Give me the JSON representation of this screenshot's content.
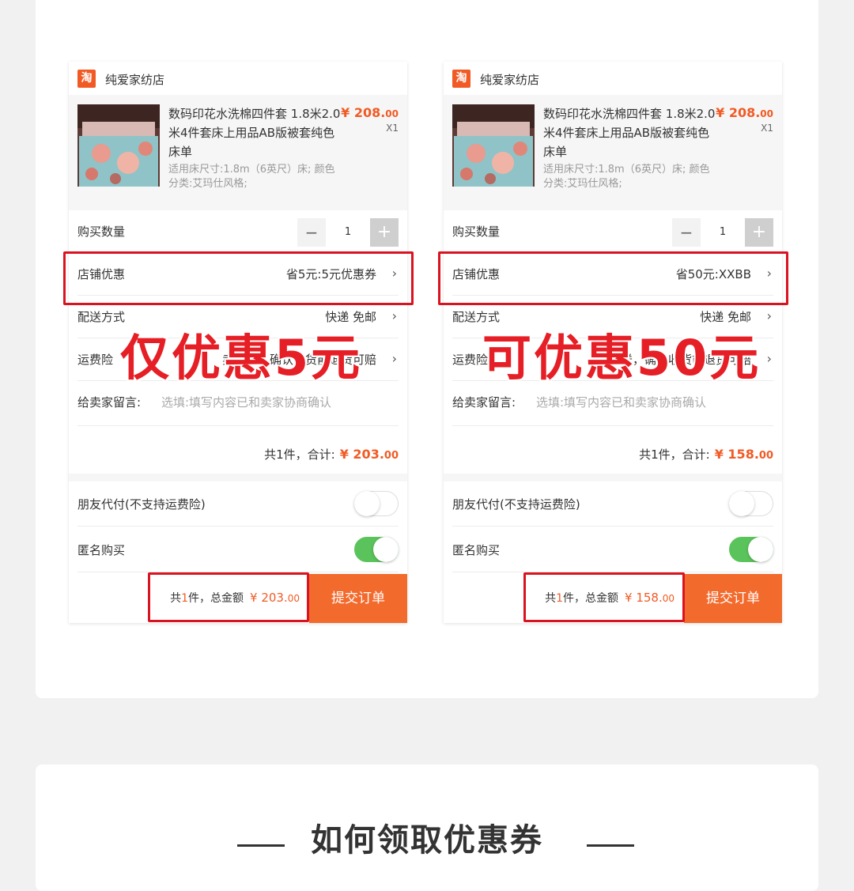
{
  "colors": {
    "accent": "#f15a24",
    "highlight": "#d9131f",
    "overlay": "#e61e25",
    "toggle_on": "#5bc35b"
  },
  "comparison": [
    {
      "shop": {
        "logo_icon": "taobao-icon",
        "logo_text": "淘",
        "name": "纯爱家纺店"
      },
      "product": {
        "title": "数码印花水洗棉四件套 1.8米2.0米4件套床上用品AB版被套纯色床单",
        "spec": "适用床尺寸:1.8m（6英尺）床; 颜色分类:艾玛仕风格;",
        "price_symbol": "¥ ",
        "price_int": "208.",
        "price_dec": "00",
        "qty": "X1"
      },
      "form": {
        "quantity_label": "购买数量",
        "quantity_value": "1",
        "minus": "−",
        "plus": "+",
        "discount_label": "店铺优惠",
        "discount_value": "省5元:5元优惠券",
        "delivery_label": "配送方式",
        "delivery_value": "快递 免邮",
        "insurance_label": "运费险",
        "insurance_value": "卖家送，确认收货前退货可赔",
        "message_label": "给卖家留言:",
        "message_placeholder": "选填:填写内容已和卖家协商确认",
        "total_prefix": "共1件，合计:",
        "total_symbol": "¥ ",
        "total_int": "203.",
        "total_dec": "00"
      },
      "toggles": {
        "friend_pay_label": "朋友代付(不支持运费险)",
        "anonymous_label": "匿名购买"
      },
      "bottom": {
        "count_pre": "共",
        "count_num": "1",
        "count_post": "件，总金额",
        "amount_symbol": "¥ ",
        "amount_int": "203.",
        "amount_dec": "00",
        "submit_label": "提交订单"
      },
      "overlay_text": "仅优惠5元"
    },
    {
      "shop": {
        "logo_icon": "taobao-icon",
        "logo_text": "淘",
        "name": "纯爱家纺店"
      },
      "product": {
        "title": "数码印花水洗棉四件套 1.8米2.0米4件套床上用品AB版被套纯色床单",
        "spec": "适用床尺寸:1.8m（6英尺）床; 颜色分类:艾玛仕风格;",
        "price_symbol": "¥ ",
        "price_int": "208.",
        "price_dec": "00",
        "qty": "X1"
      },
      "form": {
        "quantity_label": "购买数量",
        "quantity_value": "1",
        "minus": "−",
        "plus": "+",
        "discount_label": "店铺优惠",
        "discount_value": "省50元:XXBB",
        "delivery_label": "配送方式",
        "delivery_value": "快递 免邮",
        "insurance_label": "运费险",
        "insurance_value": "卖家送，确认收货前退货可赔",
        "message_label": "给卖家留言:",
        "message_placeholder": "选填:填写内容已和卖家协商确认",
        "total_prefix": "共1件，合计:",
        "total_symbol": "¥ ",
        "total_int": "158.",
        "total_dec": "00"
      },
      "toggles": {
        "friend_pay_label": "朋友代付(不支持运费险)",
        "anonymous_label": "匿名购买"
      },
      "bottom": {
        "count_pre": "共",
        "count_num": "1",
        "count_post": "件，总金额",
        "amount_symbol": "¥ ",
        "amount_int": "158.",
        "amount_dec": "00",
        "submit_label": "提交订单"
      },
      "overlay_text": "可优惠50元"
    }
  ],
  "how_to": {
    "title": "如何领取优惠券"
  }
}
